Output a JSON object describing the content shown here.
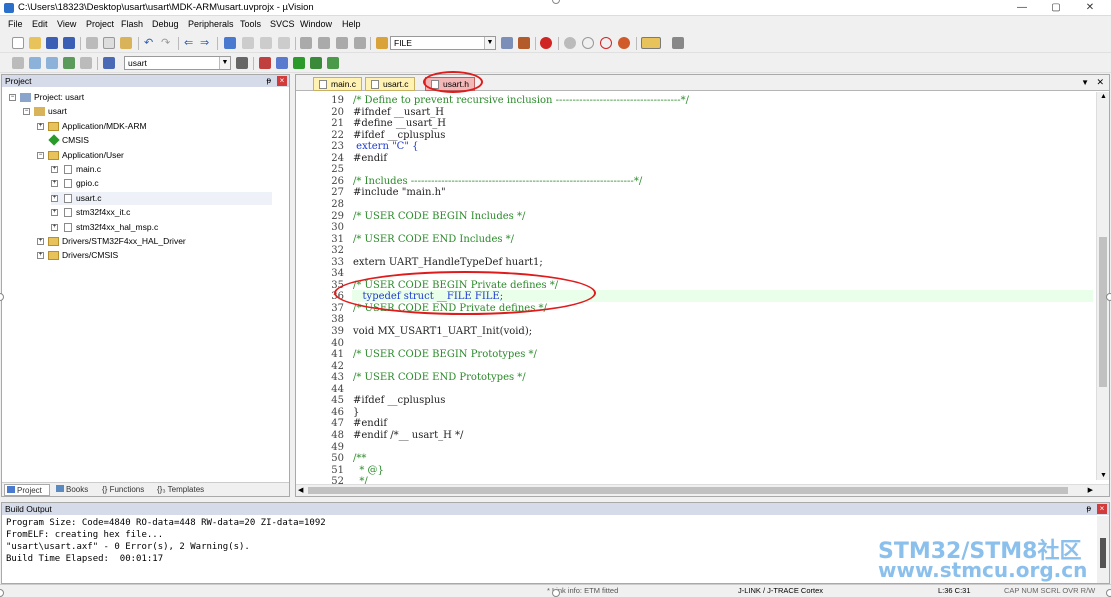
{
  "window": {
    "title": "C:\\Users\\18323\\Desktop\\usart\\usart\\MDK-ARM\\usart.uvprojx - µVision"
  },
  "menu": [
    "File",
    "Edit",
    "View",
    "Project",
    "Flash",
    "Debug",
    "Peripherals",
    "Tools",
    "SVCS",
    "Window",
    "Help"
  ],
  "toolbar": {
    "find_value": "FILE",
    "target_value": "usart"
  },
  "project_panel": {
    "title": "Project",
    "tree": [
      {
        "label": "Project: usart",
        "level": 0,
        "expander": "−",
        "icon": "project-icon"
      },
      {
        "label": "usart",
        "level": 1,
        "expander": "−",
        "icon": "target-icon"
      },
      {
        "label": "Application/MDK-ARM",
        "level": 2,
        "expander": "+",
        "icon": "folder-icon"
      },
      {
        "label": "CMSIS",
        "level": 2,
        "expander": "",
        "icon": "cmsis-icon"
      },
      {
        "label": "Application/User",
        "level": 2,
        "expander": "−",
        "icon": "folder-icon"
      },
      {
        "label": "main.c",
        "level": 3,
        "expander": "+",
        "icon": "file-icon"
      },
      {
        "label": "gpio.c",
        "level": 3,
        "expander": "+",
        "icon": "file-icon"
      },
      {
        "label": "usart.c",
        "level": 3,
        "expander": "+",
        "icon": "file-icon"
      },
      {
        "label": "stm32f4xx_it.c",
        "level": 3,
        "expander": "+",
        "icon": "file-icon"
      },
      {
        "label": "stm32f4xx_hal_msp.c",
        "level": 3,
        "expander": "+",
        "icon": "file-icon"
      },
      {
        "label": "Drivers/STM32F4xx_HAL_Driver",
        "level": 2,
        "expander": "+",
        "icon": "folder-icon"
      },
      {
        "label": "Drivers/CMSIS",
        "level": 2,
        "expander": "+",
        "icon": "folder-icon"
      }
    ],
    "tabs": [
      "Project",
      "Books",
      "{} Functions",
      "{}₃ Templates"
    ]
  },
  "editor": {
    "tabs": [
      "main.c",
      "usart.c",
      "usart.h"
    ],
    "active_tab": "usart.h",
    "lines": [
      {
        "n": "19",
        "text": "/* Define to prevent recursive inclusion -------------------------------------*/",
        "cls": "cm"
      },
      {
        "n": "20",
        "text": "#ifndef __usart_H",
        "cls": "pp"
      },
      {
        "n": "21",
        "text": "#define __usart_H",
        "cls": "pp"
      },
      {
        "n": "22",
        "text": "#ifdef __cplusplus",
        "cls": "pp"
      },
      {
        "n": "23",
        "text": " extern \"C\" {",
        "cls": "kw"
      },
      {
        "n": "24",
        "text": "#endif",
        "cls": "pp"
      },
      {
        "n": "25",
        "text": "",
        "cls": "pp"
      },
      {
        "n": "26",
        "text": "/* Includes ------------------------------------------------------------------*/",
        "cls": "cm"
      },
      {
        "n": "27",
        "text": "#include \"main.h\"",
        "cls": "pp"
      },
      {
        "n": "28",
        "text": "",
        "cls": "pp"
      },
      {
        "n": "29",
        "text": "/* USER CODE BEGIN Includes */",
        "cls": "cm"
      },
      {
        "n": "30",
        "text": "",
        "cls": "pp"
      },
      {
        "n": "31",
        "text": "/* USER CODE END Includes */",
        "cls": "cm"
      },
      {
        "n": "32",
        "text": "",
        "cls": "pp"
      },
      {
        "n": "33",
        "text": "extern UART_HandleTypeDef huart1;",
        "cls": "pp"
      },
      {
        "n": "34",
        "text": "",
        "cls": "pp"
      },
      {
        "n": "35",
        "text": "/* USER CODE BEGIN Private defines */",
        "cls": "cm"
      },
      {
        "n": "36",
        "text": "   typedef struct __FILE FILE;",
        "cls": "kw"
      },
      {
        "n": "37",
        "text": "/* USER CODE END Private defines */",
        "cls": "cm"
      },
      {
        "n": "38",
        "text": "",
        "cls": "pp"
      },
      {
        "n": "39",
        "text": "void MX_USART1_UART_Init(void);",
        "cls": "pp"
      },
      {
        "n": "40",
        "text": "",
        "cls": "pp"
      },
      {
        "n": "41",
        "text": "/* USER CODE BEGIN Prototypes */",
        "cls": "cm"
      },
      {
        "n": "42",
        "text": "",
        "cls": "pp"
      },
      {
        "n": "43",
        "text": "/* USER CODE END Prototypes */",
        "cls": "cm"
      },
      {
        "n": "44",
        "text": "",
        "cls": "pp"
      },
      {
        "n": "45",
        "text": "#ifdef __cplusplus",
        "cls": "pp"
      },
      {
        "n": "46",
        "text": "}",
        "cls": "pp"
      },
      {
        "n": "47",
        "text": "#endif",
        "cls": "pp"
      },
      {
        "n": "48",
        "text": "#endif /*__ usart_H */",
        "cls": "pp"
      },
      {
        "n": "49",
        "text": "",
        "cls": "pp"
      },
      {
        "n": "50",
        "text": "/**",
        "cls": "cm"
      },
      {
        "n": "51",
        "text": "  * @}",
        "cls": "cm"
      },
      {
        "n": "52",
        "text": "  */",
        "cls": "cm"
      }
    ]
  },
  "build_output": {
    "title": "Build Output",
    "lines": [
      "Program Size: Code=4840 RO-data=448 RW-data=20 ZI-data=1092",
      "FromELF: creating hex file...",
      "\"usart\\usart.axf\" - 0 Error(s), 2 Warning(s).",
      "Build Time Elapsed:  00:01:17"
    ]
  },
  "statusbar": {
    "link_info": "* Link info: ETM fitted",
    "debugger": "J-LINK / J-TRACE Cortex",
    "position": "L:36 C:31",
    "flags": "CAP NUM SCRL OVR R/W"
  },
  "watermark": {
    "line1": "STM32/STM8社区",
    "line2": "www.stmcu.org.cn"
  },
  "colors": {
    "annotation": "#e01b1b",
    "comment": "#2a8a2a",
    "keyword": "#1e3ad0"
  }
}
